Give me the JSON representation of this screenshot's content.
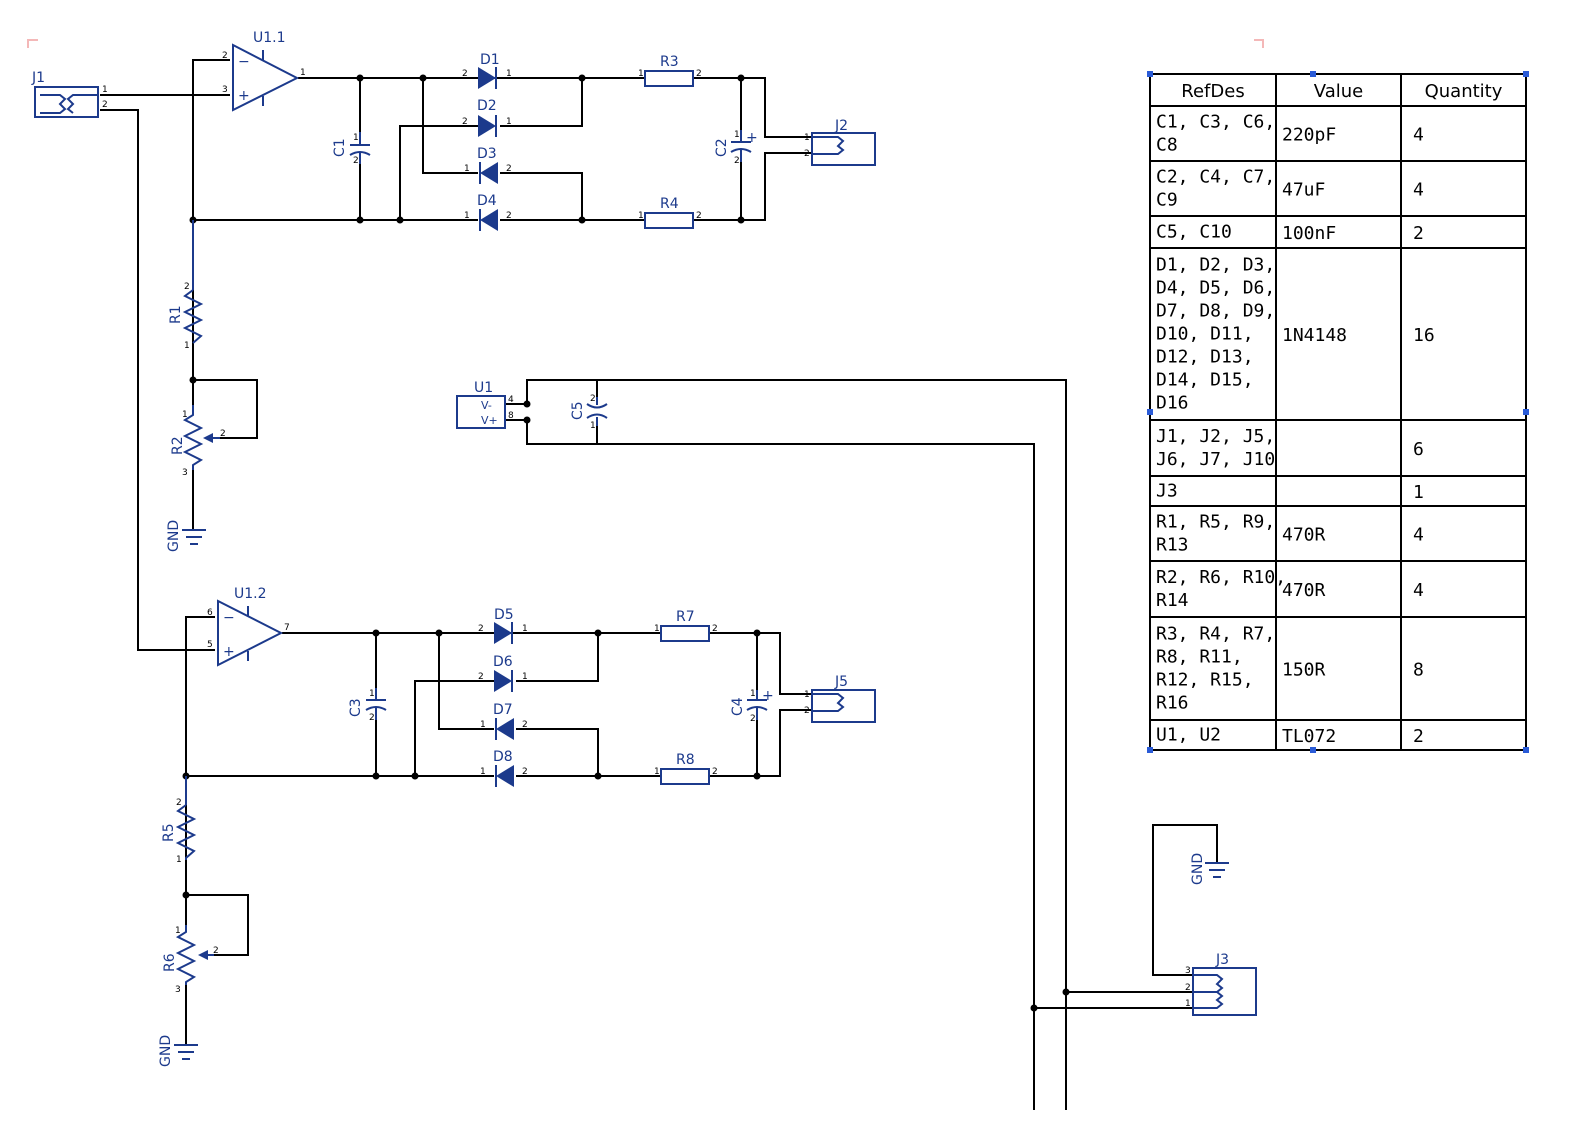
{
  "components": {
    "U1_1": "U1.1",
    "U1_2": "U1.2",
    "U1": "U1",
    "J1": "J1",
    "J2": "J2",
    "J3": "J3",
    "J5": "J5",
    "C1": "C1",
    "C2": "C2",
    "C3": "C3",
    "C4": "C4",
    "C5": "C5",
    "D1": "D1",
    "D2": "D2",
    "D3": "D3",
    "D4": "D4",
    "D5": "D5",
    "D6": "D6",
    "D7": "D7",
    "D8": "D8",
    "R1": "R1",
    "R2": "R2",
    "R3": "R3",
    "R4": "R4",
    "R5": "R5",
    "R6": "R6",
    "R7": "R7",
    "R8": "R8",
    "GND": "GND",
    "Vminus": "V-",
    "Vplus": "V+"
  },
  "pins": {
    "p1": "1",
    "p2": "2",
    "p3": "3",
    "p4": "4",
    "p5": "5",
    "p6": "6",
    "p7": "7",
    "p8": "8",
    "minus": "−",
    "plus": "+"
  },
  "bom": {
    "headers": [
      "RefDes",
      "Value",
      "Quantity"
    ],
    "rows": [
      {
        "ref": [
          "C1, C3, C6,",
          "C8"
        ],
        "value": "220pF",
        "qty": "4"
      },
      {
        "ref": [
          "C2, C4, C7,",
          "C9"
        ],
        "value": "47uF",
        "qty": "4"
      },
      {
        "ref": [
          "C5, C10"
        ],
        "value": "100nF",
        "qty": "2"
      },
      {
        "ref": [
          "D1, D2, D3,",
          "D4, D5, D6,",
          "D7, D8, D9,",
          "D10, D11,",
          "D12, D13,",
          "D14, D15,",
          "D16"
        ],
        "value": "1N4148",
        "qty": "16"
      },
      {
        "ref": [
          "J1, J2, J5,",
          "J6, J7, J10"
        ],
        "value": "",
        "qty": "6"
      },
      {
        "ref": [
          "J3"
        ],
        "value": "",
        "qty": "1"
      },
      {
        "ref": [
          "R1, R5, R9,",
          "R13"
        ],
        "value": "470R",
        "qty": "4"
      },
      {
        "ref": [
          "R2, R6, R10,",
          "R14"
        ],
        "value": "470R",
        "qty": "4"
      },
      {
        "ref": [
          "R3, R4, R7,",
          "R8, R11,",
          "R12, R15,",
          "R16"
        ],
        "value": "150R",
        "qty": "8"
      },
      {
        "ref": [
          "U1, U2"
        ],
        "value": "TL072",
        "qty": "2"
      }
    ]
  },
  "colors": {
    "symbol": "#1c3a8c",
    "wire": "#000000",
    "selection": "#2a5bd7",
    "corner_mark": "#f4b8b8"
  }
}
